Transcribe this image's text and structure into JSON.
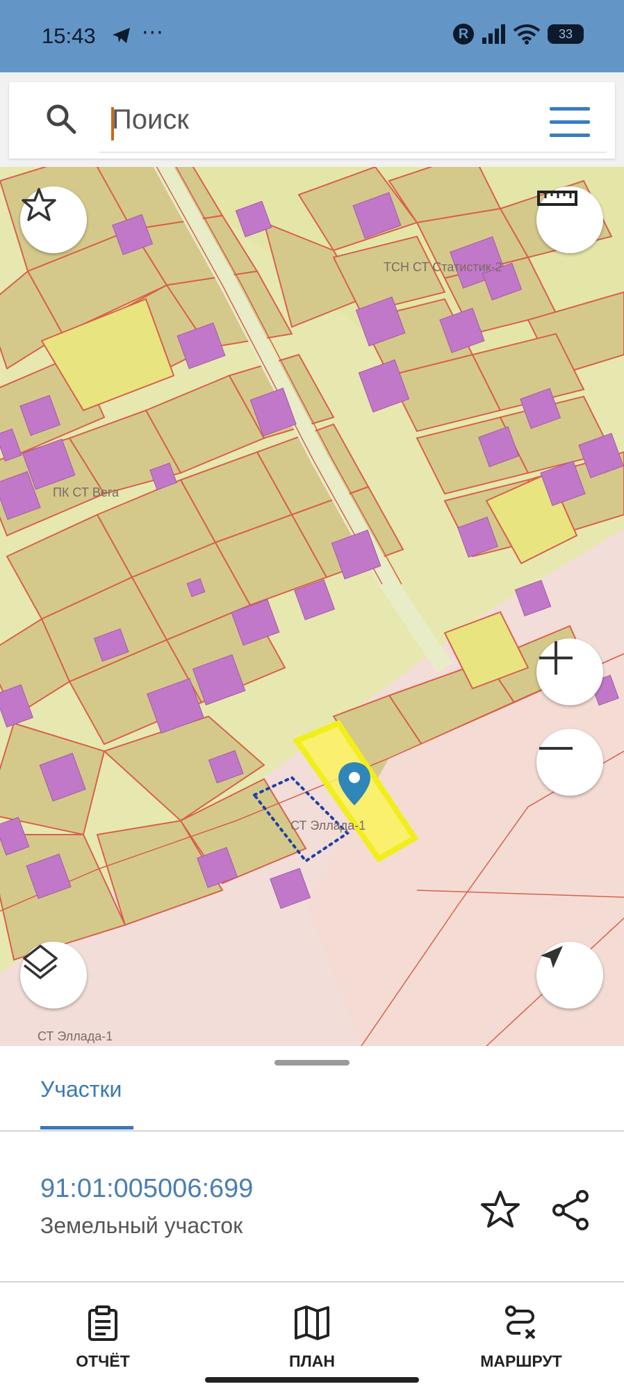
{
  "status_bar": {
    "time": "15:43",
    "notification_dots": "···",
    "battery": "33"
  },
  "search": {
    "placeholder": "Поиск",
    "value": ""
  },
  "map": {
    "labels": {
      "tsn": "ТСН СТ Статистик-2",
      "pk": "ПК СТ Вега",
      "st_center": "СТ Эллада-1",
      "st_bottom": "СТ Эллада-1"
    },
    "colors": {
      "parcel": "#d5cc8f",
      "road": "#e6e7a6",
      "border": "#d9604a",
      "building": "#c278c8",
      "selected": "#fbf25c",
      "background": "#f2ddd8"
    },
    "icons": {
      "favorite": "star-outline-icon",
      "ruler": "ruler-icon",
      "zoom_in": "plus-icon",
      "zoom_out": "minus-icon",
      "layers": "layers-icon",
      "location": "navigation-arrow-icon",
      "marker": "map-pin-icon"
    }
  },
  "sheet": {
    "tab": "Участки",
    "cadastral_number": "91:01:005006:699",
    "parcel_type": "Земельный участок"
  },
  "bottom_nav": {
    "report": "ОТЧЁТ",
    "plan": "ПЛАН",
    "route": "МАРШРУТ"
  }
}
